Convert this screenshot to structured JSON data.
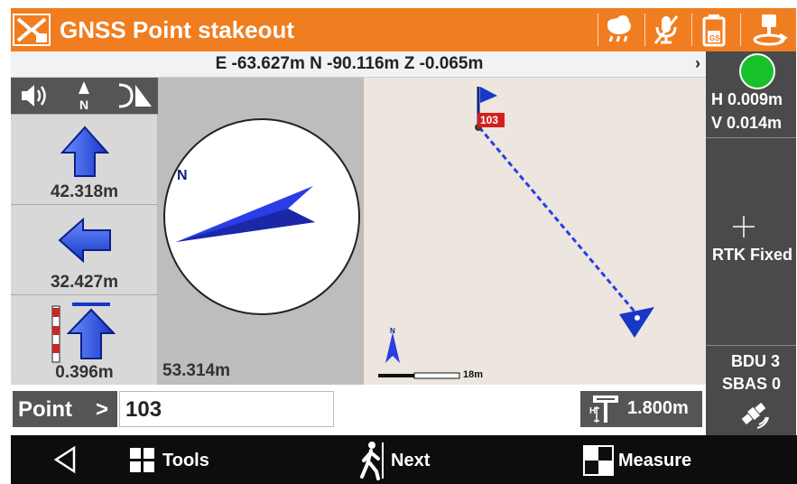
{
  "header": {
    "title": "GNSS Point stakeout",
    "icons": [
      "app-logo-icon",
      "weather-icon",
      "mic-off-icon",
      "battery-icon",
      "receiver-icon"
    ],
    "battery_label": "GS"
  },
  "coord_bar": {
    "text": "E -63.627m N -90.116m Z -0.065m",
    "chevron": "›"
  },
  "status": {
    "h_precision": "H 0.009m",
    "v_precision": "V 0.014m",
    "solution": "RTK Fixed",
    "bdu": "BDU 3",
    "sbas": "SBAS 0",
    "led_color": "#18c12a"
  },
  "nav": {
    "forward_dist": "42.318m",
    "left_dist": "32.427m",
    "height_dist": "0.396m",
    "north_label": "N"
  },
  "compass": {
    "north_label": "N",
    "distance": "53.314m"
  },
  "map": {
    "point_label": "103",
    "scale_label": "18m",
    "north_label": "N"
  },
  "point_row": {
    "label": "Point",
    "chevron": ">",
    "value": "103",
    "antenna_height": "1.800m",
    "antenna_h_label": "H"
  },
  "bottom_bar": {
    "tools": "Tools",
    "next": "Next",
    "measure": "Measure"
  },
  "colors": {
    "accent": "#f07d1f",
    "arrow_blue": "#1f4fd8",
    "status_bg": "#4a4a4a"
  }
}
